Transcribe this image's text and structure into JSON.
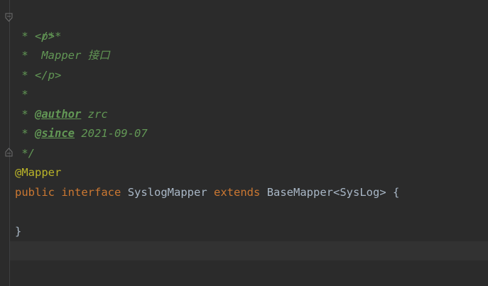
{
  "editor": {
    "colors": {
      "background": "#2b2b2b",
      "doc_comment": "#629755",
      "annotation": "#bbb529",
      "keyword": "#cc7832",
      "identifier": "#a9b7c6",
      "current_line": "#323232"
    },
    "fold_icons": [
      "fold-start-icon",
      "fold-end-icon"
    ],
    "lines": {
      "l1": "/**",
      "l2_prefix": " * ",
      "l2_text": "<p>",
      "l3_prefix": " *  ",
      "l3_text": "Mapper 接口",
      "l4_prefix": " * ",
      "l4_text": "</p>",
      "l5": " *",
      "l6_prefix": " * ",
      "l6_tag": "@author",
      "l6_value": " zrc",
      "l7_prefix": " * ",
      "l7_tag": "@since",
      "l7_value": " 2021-09-07",
      "l8": " */",
      "l9": "@Mapper",
      "l10_kw1": "public",
      "l10_kw2": "interface",
      "l10_name": "SyslogMapper",
      "l10_kw3": "extends",
      "l10_super": "BaseMapper<SysLog>",
      "l10_brace": "{",
      "l12": "}"
    }
  }
}
